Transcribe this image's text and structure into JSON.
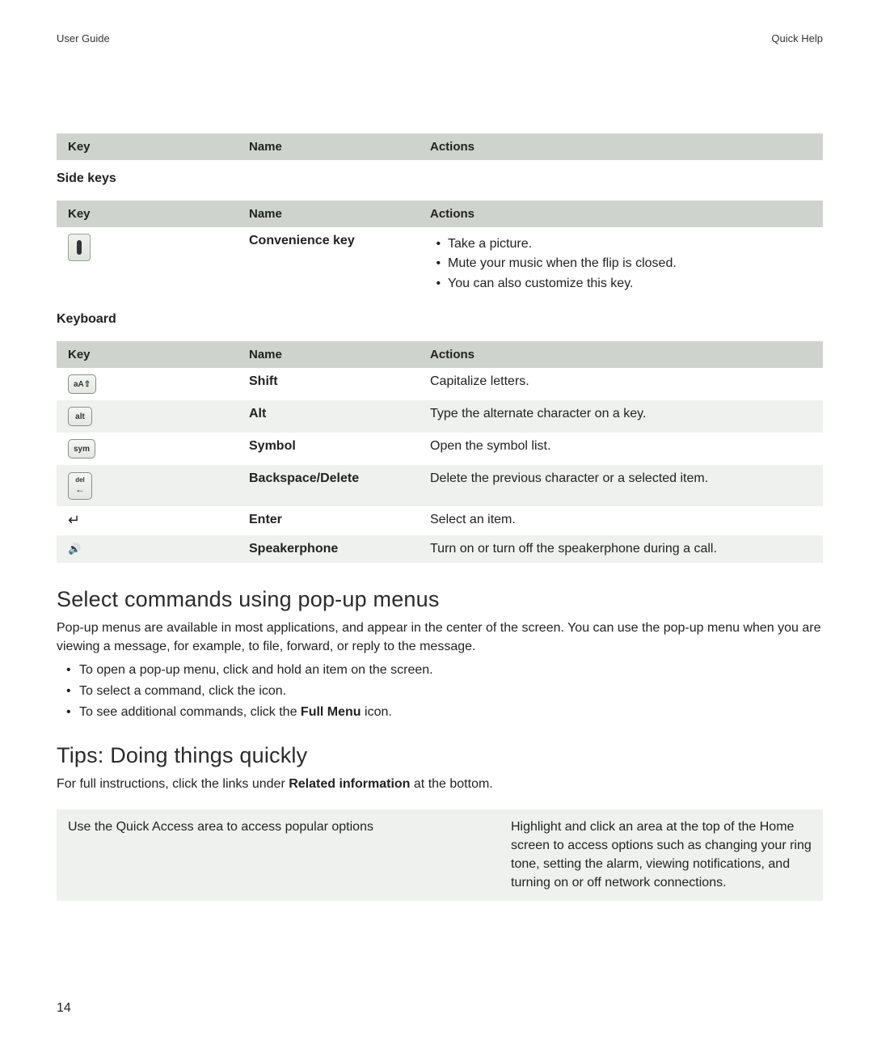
{
  "header": {
    "left": "User Guide",
    "right": "Quick Help"
  },
  "table_cols": {
    "key": "Key",
    "name": "Name",
    "actions": "Actions"
  },
  "sections": {
    "side_keys": "Side keys",
    "keyboard": "Keyboard"
  },
  "side_keys_rows": [
    {
      "icon": "convenience-key-icon",
      "name": "Convenience key",
      "actions": [
        "Take a picture.",
        "Mute your music when the flip is closed.",
        "You can also customize this key."
      ]
    }
  ],
  "keyboard_rows": [
    {
      "icon": "shift-keycap",
      "cap": "aA⇧",
      "name": "Shift",
      "action": "Capitalize letters."
    },
    {
      "icon": "alt-keycap",
      "cap": "alt",
      "name": "Alt",
      "action": "Type the alternate character on a key."
    },
    {
      "icon": "sym-keycap",
      "cap": "sym",
      "name": "Symbol",
      "action": "Open the symbol list."
    },
    {
      "icon": "del-keycap",
      "cap": "del",
      "name": "Backspace/Delete",
      "action": "Delete the previous character or a selected item."
    },
    {
      "icon": "enter-keycap",
      "cap": "↵",
      "name": "Enter",
      "action": "Select an item."
    },
    {
      "icon": "speaker-keycap",
      "cap": "🔊",
      "name": "Speakerphone",
      "action": "Turn on or turn off the speakerphone during a call."
    }
  ],
  "popup": {
    "heading": "Select commands using pop-up menus",
    "para": "Pop-up menus are available in most applications, and appear in the center of the screen. You can use the pop-up menu when you are viewing a message, for example, to file, forward, or reply to the message.",
    "bullets": [
      "To open a pop-up menu, click and hold an item on the screen.",
      "To select a command, click the icon."
    ],
    "bullet3_pre": "To see additional commands, click the ",
    "bullet3_bold": "Full Menu",
    "bullet3_post": " icon."
  },
  "tips": {
    "heading": "Tips: Doing things quickly",
    "intro_pre": "For full instructions, click the links under ",
    "intro_bold": "Related information",
    "intro_post": " at the bottom.",
    "rows": [
      {
        "left": "Use the Quick Access area to access popular options",
        "right": "Highlight and click an area at the top of the Home screen to access options such as changing your ring tone, setting the alarm, viewing notifications, and turning on or off network connections."
      }
    ]
  },
  "page_number": "14"
}
